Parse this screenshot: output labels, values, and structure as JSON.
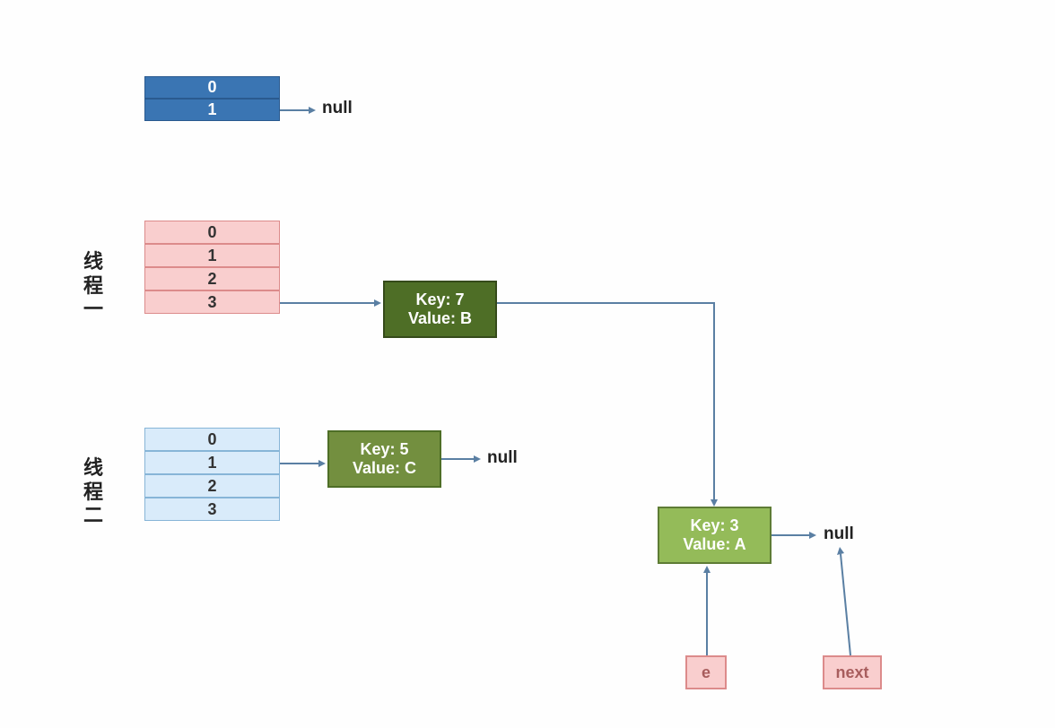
{
  "table_blue": {
    "rows": [
      "0",
      "1"
    ]
  },
  "table_pink": {
    "rows": [
      "0",
      "1",
      "2",
      "3"
    ]
  },
  "table_lightblue": {
    "rows": [
      "0",
      "1",
      "2",
      "3"
    ]
  },
  "labels": {
    "thread1": "线\n程\n一",
    "thread2": "线\n程\n二",
    "null1": "null",
    "null2": "null",
    "null3": "null"
  },
  "nodes": {
    "key7": {
      "key_line": "Key: 7",
      "value_line": "Value: B"
    },
    "key5": {
      "key_line": "Key: 5",
      "value_line": "Value: C"
    },
    "key3": {
      "key_line": "Key: 3",
      "value_line": "Value: A"
    }
  },
  "boxes": {
    "e": "e",
    "next": "next"
  }
}
